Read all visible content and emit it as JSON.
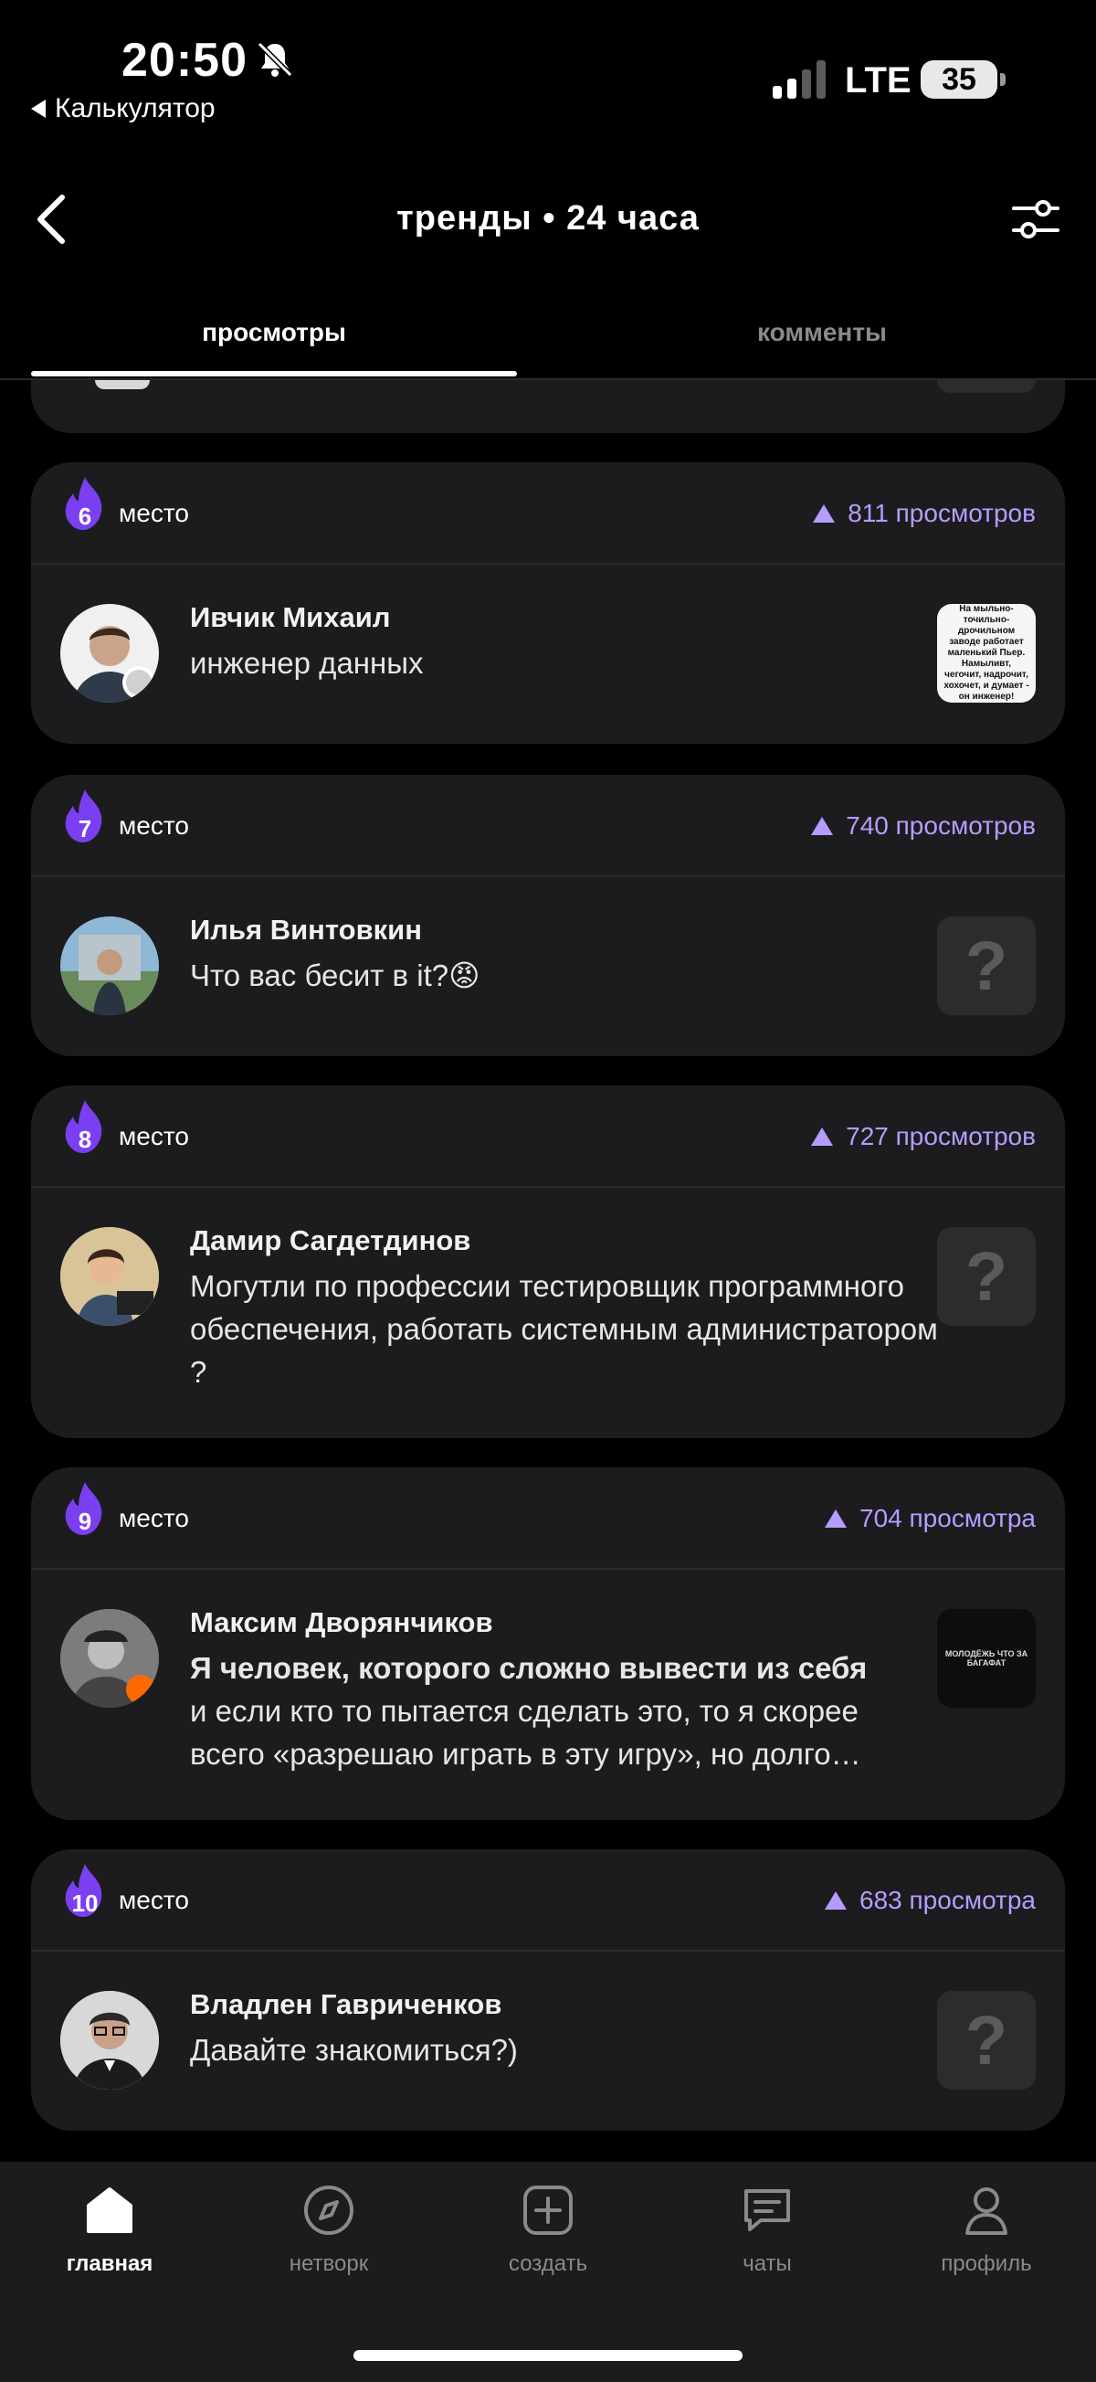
{
  "status": {
    "time": "20:50",
    "back_app": "Калькулятор",
    "network": "LTE",
    "battery": "35"
  },
  "header": {
    "title": "тренды • 24 часа"
  },
  "tabs": [
    {
      "label": "просмотры",
      "active": true
    },
    {
      "label": "комменты",
      "active": false
    }
  ],
  "accent_color": "#b79cff",
  "flame_color": "#7b3ff2",
  "entries": [
    {
      "rank": "6",
      "place_label": "место",
      "views": "811 просмотров",
      "name": "Ивчик Михаил",
      "text": "инженер данных",
      "thumb_text": "На мыльно-точильно-дрочильном заводе работает маленький Пьер. Намыливт, чегочит, надрочит, хохочет, и думает - он инженер!"
    },
    {
      "rank": "7",
      "place_label": "место",
      "views": "740 просмотров",
      "name": "Илья Винтовкин",
      "text": "Что вас бесит в it?😡",
      "thumb": "?"
    },
    {
      "rank": "8",
      "place_label": "место",
      "views": "727 просмотров",
      "name": "Дамир Сагдетдинов",
      "text": "Могутли по профессии тестировщик программного обеспечения, работать системным администратором ?",
      "thumb": "?"
    },
    {
      "rank": "9",
      "place_label": "место",
      "views": "704 просмотра",
      "name": "Максим Дворянчиков",
      "text_bold": "Я человек, которого сложно вывести из себя",
      "text": "и если кто то пытается сделать это, то я скорее всего «разрешаю играть в эту игру», но долго…",
      "thumb_text": "МОЛОДЁЖЬ ЧТО ЗА БАГАФАТ"
    },
    {
      "rank": "10",
      "place_label": "место",
      "views": "683 просмотра",
      "name": "Владлен Гавриченков",
      "text": "Давайте знакомиться?)",
      "thumb": "?"
    }
  ],
  "bottom_nav": [
    {
      "label": "главная",
      "icon": "home-icon",
      "active": true
    },
    {
      "label": "нетворк",
      "icon": "compass-icon",
      "active": false
    },
    {
      "label": "создать",
      "icon": "plus-square-icon",
      "active": false
    },
    {
      "label": "чаты",
      "icon": "chat-icon",
      "active": false
    },
    {
      "label": "профиль",
      "icon": "profile-icon",
      "active": false
    }
  ]
}
